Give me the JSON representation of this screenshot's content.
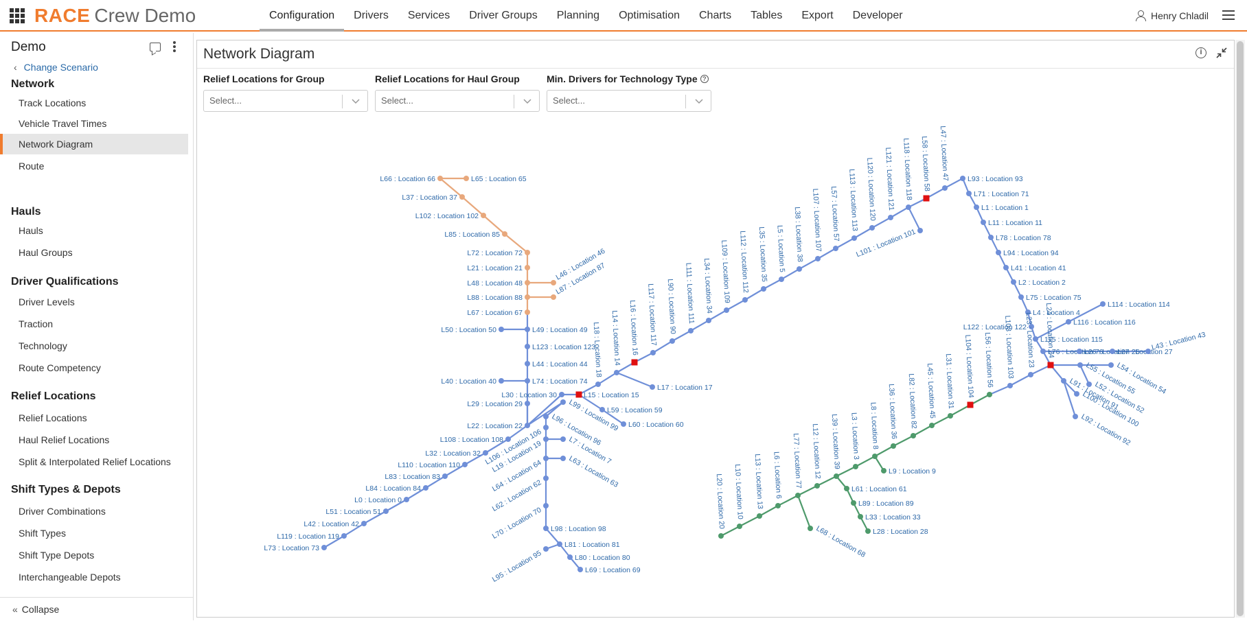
{
  "header": {
    "brand_race": "RACE",
    "brand_sub": "Crew Demo",
    "nav": [
      "Configuration",
      "Drivers",
      "Services",
      "Driver Groups",
      "Planning",
      "Optimisation",
      "Charts",
      "Tables",
      "Export",
      "Developer"
    ],
    "active_nav": "Configuration",
    "user": "Henry Chladil"
  },
  "sidebar": {
    "scenario": "Demo",
    "change_scenario": "Change Scenario",
    "sections": [
      {
        "title": "Network",
        "items": [
          "Track Locations",
          "Vehicle Travel Times",
          "Network Diagram",
          "Route"
        ]
      },
      {
        "title": "Hauls",
        "items": [
          "Hauls",
          "Haul Groups"
        ]
      },
      {
        "title": "Driver Qualifications",
        "items": [
          "Driver Levels",
          "Traction",
          "Technology",
          "Route Competency"
        ]
      },
      {
        "title": "Relief Locations",
        "items": [
          "Relief Locations",
          "Haul Relief Locations",
          "Split & Interpolated Relief Locations"
        ]
      },
      {
        "title": "Shift Types & Depots",
        "items": [
          "Driver Combinations",
          "Shift Types",
          "Shift Type Depots",
          "Interchangeable Depots"
        ]
      }
    ],
    "active_item": "Network Diagram",
    "collapse": "Collapse"
  },
  "panel": {
    "title": "Network Diagram",
    "filters": [
      {
        "label": "Relief Locations for Group",
        "placeholder": "Select..."
      },
      {
        "label": "Relief Locations for Haul Group",
        "placeholder": "Select..."
      },
      {
        "label": "Min. Drivers for Technology Type",
        "placeholder": "Select..."
      }
    ]
  },
  "colors": {
    "accent": "#f07c2e",
    "blue_line": "#6f8fd8",
    "orange_line": "#e8a87c",
    "green_line": "#4e9a6b",
    "label": "#2d68a8",
    "relief_marker": "#e01010"
  },
  "network": {
    "nodes": [
      {
        "id": "L66",
        "label": "L66 : Location 66",
        "line": "orange"
      },
      {
        "id": "L65",
        "label": "L65 : Location 65",
        "line": "orange"
      },
      {
        "id": "L37",
        "label": "L37 : Location 37",
        "line": "orange"
      },
      {
        "id": "L102",
        "label": "L102 : Location 102",
        "line": "orange"
      },
      {
        "id": "L85",
        "label": "L85 : Location 85",
        "line": "orange"
      },
      {
        "id": "L72",
        "label": "L72 : Location 72",
        "line": "orange"
      },
      {
        "id": "L21",
        "label": "L21 : Location 21",
        "line": "orange"
      },
      {
        "id": "L48",
        "label": "L48 : Location 48",
        "line": "orange"
      },
      {
        "id": "L46",
        "label": "L46 : Location 46",
        "line": "orange"
      },
      {
        "id": "L88",
        "label": "L88 : Location 88",
        "line": "orange"
      },
      {
        "id": "L87",
        "label": "L87 : Location 87",
        "line": "orange"
      },
      {
        "id": "L67",
        "label": "L67 : Location 67",
        "line": "orange"
      },
      {
        "id": "L50",
        "label": "L50 : Location 50",
        "line": "blue"
      },
      {
        "id": "L49",
        "label": "L49 : Location 49",
        "line": "blue"
      },
      {
        "id": "L123",
        "label": "L123 : Location 123",
        "line": "blue"
      },
      {
        "id": "L44",
        "label": "L44 : Location 44",
        "line": "blue"
      },
      {
        "id": "L40",
        "label": "L40 : Location 40",
        "line": "blue"
      },
      {
        "id": "L74",
        "label": "L74 : Location 74",
        "line": "blue"
      },
      {
        "id": "L29",
        "label": "L29 : Location 29",
        "line": "blue"
      },
      {
        "id": "L30",
        "label": "L30 : Location 30",
        "line": "blue"
      },
      {
        "id": "L15",
        "label": "L15 : Location 15",
        "line": "blue",
        "relief": true
      },
      {
        "id": "L22",
        "label": "L22 : Location 22",
        "line": "blue"
      },
      {
        "id": "L108",
        "label": "L108 : Location 108",
        "line": "blue"
      },
      {
        "id": "L32",
        "label": "L32 : Location 32",
        "line": "blue"
      },
      {
        "id": "L110",
        "label": "L110 : Location 110",
        "line": "blue"
      },
      {
        "id": "L83",
        "label": "L83 : Location 83",
        "line": "blue"
      },
      {
        "id": "L84",
        "label": "L84 : Location 84",
        "line": "blue"
      },
      {
        "id": "L0",
        "label": "L0 : Location 0",
        "line": "blue"
      },
      {
        "id": "L51",
        "label": "L51 : Location 51",
        "line": "blue"
      },
      {
        "id": "L42",
        "label": "L42 : Location 42",
        "line": "blue"
      },
      {
        "id": "L119",
        "label": "L119 : Location 119",
        "line": "blue"
      },
      {
        "id": "L73",
        "label": "L73 : Location 73",
        "line": "blue"
      },
      {
        "id": "L99",
        "label": "L99 : Location 99",
        "line": "blue"
      },
      {
        "id": "L96",
        "label": "L96 : Location 96",
        "line": "blue"
      },
      {
        "id": "L106",
        "label": "L106 : Location 106",
        "line": "blue"
      },
      {
        "id": "L19",
        "label": "L19 : Location 19",
        "line": "blue"
      },
      {
        "id": "L7",
        "label": "L7 : Location 7",
        "line": "blue"
      },
      {
        "id": "L64",
        "label": "L64 : Location 64",
        "line": "blue"
      },
      {
        "id": "L63",
        "label": "L63 : Location 63",
        "line": "blue"
      },
      {
        "id": "L62",
        "label": "L62 : Location 62",
        "line": "blue"
      },
      {
        "id": "L70",
        "label": "L70 : Location 70",
        "line": "blue"
      },
      {
        "id": "L98",
        "label": "L98 : Location 98",
        "line": "blue"
      },
      {
        "id": "L81",
        "label": "L81 : Location 81",
        "line": "blue"
      },
      {
        "id": "L80",
        "label": "L80 : Location 80",
        "line": "blue"
      },
      {
        "id": "L95",
        "label": "L95 : Location 95",
        "line": "blue"
      },
      {
        "id": "L69",
        "label": "L69 : Location 69",
        "line": "blue"
      },
      {
        "id": "L59",
        "label": "L59 : Location 59",
        "line": "blue"
      },
      {
        "id": "L60",
        "label": "L60 : Location 60",
        "line": "blue"
      },
      {
        "id": "L18",
        "label": "L18 : Location 18",
        "line": "blue"
      },
      {
        "id": "L14",
        "label": "L14 : Location 14",
        "line": "blue"
      },
      {
        "id": "L16",
        "label": "L16 : Location 16",
        "line": "blue",
        "relief": true
      },
      {
        "id": "L17",
        "label": "L17 : Location 17",
        "line": "blue"
      },
      {
        "id": "L117",
        "label": "L117 : Location 117",
        "line": "blue"
      },
      {
        "id": "L90",
        "label": "L90 : Location 90",
        "line": "blue"
      },
      {
        "id": "L111",
        "label": "L111 : Location 111",
        "line": "blue"
      },
      {
        "id": "L34",
        "label": "L34 : Location 34",
        "line": "blue"
      },
      {
        "id": "L109",
        "label": "L109 : Location 109",
        "line": "blue"
      },
      {
        "id": "L112",
        "label": "L112 : Location 112",
        "line": "blue"
      },
      {
        "id": "L35",
        "label": "L35 : Location 35",
        "line": "blue"
      },
      {
        "id": "L5",
        "label": "L5 : Location 5",
        "line": "blue"
      },
      {
        "id": "L38",
        "label": "L38 : Location 38",
        "line": "blue"
      },
      {
        "id": "L107",
        "label": "L107 : Location 107",
        "line": "blue"
      },
      {
        "id": "L57",
        "label": "L57 : Location 57",
        "line": "blue"
      },
      {
        "id": "L113",
        "label": "L113 : Location 113",
        "line": "blue"
      },
      {
        "id": "L120",
        "label": "L120 : Location 120",
        "line": "blue"
      },
      {
        "id": "L121",
        "label": "L121 : Location 121",
        "line": "blue"
      },
      {
        "id": "L118",
        "label": "L118 : Location 118",
        "line": "blue"
      },
      {
        "id": "L101",
        "label": "L101 : Location 101",
        "line": "blue"
      },
      {
        "id": "L58",
        "label": "L58 : Location 58",
        "line": "blue",
        "relief": true
      },
      {
        "id": "L47",
        "label": "L47 : Location 47",
        "line": "blue"
      },
      {
        "id": "L93",
        "label": "L93 : Location 93",
        "line": "blue"
      },
      {
        "id": "L71",
        "label": "L71 : Location 71",
        "line": "blue"
      },
      {
        "id": "L1",
        "label": "L1 : Location 1",
        "line": "blue"
      },
      {
        "id": "L11",
        "label": "L11 : Location 11",
        "line": "blue"
      },
      {
        "id": "L78",
        "label": "L78 : Location 78",
        "line": "blue"
      },
      {
        "id": "L94",
        "label": "L94 : Location 94",
        "line": "blue"
      },
      {
        "id": "L41",
        "label": "L41 : Location 41",
        "line": "blue"
      },
      {
        "id": "L2",
        "label": "L2 : Location 2",
        "line": "blue"
      },
      {
        "id": "L75",
        "label": "L75 : Location 75",
        "line": "blue"
      },
      {
        "id": "L4",
        "label": "L4 : Location 4",
        "line": "blue"
      },
      {
        "id": "L114",
        "label": "L114 : Location 114",
        "line": "blue"
      },
      {
        "id": "L116",
        "label": "L116 : Location 116",
        "line": "blue"
      },
      {
        "id": "L122",
        "label": "L122 : Location 122",
        "line": "blue"
      },
      {
        "id": "L115",
        "label": "L115 : Location 115",
        "line": "blue"
      },
      {
        "id": "L76",
        "label": "L76 : Location 76",
        "line": "blue"
      },
      {
        "id": "L26",
        "label": "L26 : Location 26",
        "line": "blue"
      },
      {
        "id": "L27",
        "label": "L27 : Location 27",
        "line": "blue"
      },
      {
        "id": "L43",
        "label": "L43 : Location 43",
        "line": "blue"
      },
      {
        "id": "L24",
        "label": "L24 : Location 24",
        "line": "blue",
        "relief": true
      },
      {
        "id": "L54",
        "label": "L54 : Location 54",
        "line": "blue"
      },
      {
        "id": "L55",
        "label": "L55 : Location 55",
        "line": "blue"
      },
      {
        "id": "L52",
        "label": "L52 : Location 52",
        "line": "blue"
      },
      {
        "id": "L91",
        "label": "L91 : Location 91",
        "line": "blue"
      },
      {
        "id": "L100",
        "label": "L100 : Location 100",
        "line": "blue"
      },
      {
        "id": "L92",
        "label": "L92 : Location 92",
        "line": "blue"
      },
      {
        "id": "L23",
        "label": "L23 : Location 23",
        "line": "blue"
      },
      {
        "id": "L103",
        "label": "L103 : Location 103",
        "line": "blue"
      },
      {
        "id": "L104",
        "label": "L104 : Location 104",
        "line": "green",
        "relief": true
      },
      {
        "id": "L56",
        "label": "L56 : Location 56",
        "line": "green"
      },
      {
        "id": "L31",
        "label": "L31 : Location 31",
        "line": "green"
      },
      {
        "id": "L45",
        "label": "L45 : Location 45",
        "line": "green"
      },
      {
        "id": "L82",
        "label": "L82 : Location 82",
        "line": "green"
      },
      {
        "id": "L36",
        "label": "L36 : Location 36",
        "line": "green"
      },
      {
        "id": "L8",
        "label": "L8 : Location 8",
        "line": "green"
      },
      {
        "id": "L9",
        "label": "L9 : Location 9",
        "line": "green"
      },
      {
        "id": "L3",
        "label": "L3 : Location 3",
        "line": "green"
      },
      {
        "id": "L39",
        "label": "L39 : Location 39",
        "line": "green"
      },
      {
        "id": "L61",
        "label": "L61 : Location 61",
        "line": "green"
      },
      {
        "id": "L89",
        "label": "L89 : Location 89",
        "line": "green"
      },
      {
        "id": "L33",
        "label": "L33 : Location 33",
        "line": "green"
      },
      {
        "id": "L28",
        "label": "L28 : Location 28",
        "line": "green"
      },
      {
        "id": "L12",
        "label": "L12 : Location 12",
        "line": "green"
      },
      {
        "id": "L77",
        "label": "L77 : Location 77",
        "line": "green"
      },
      {
        "id": "L68",
        "label": "L68 : Location 68",
        "line": "green"
      },
      {
        "id": "L6",
        "label": "L6 : Location 6",
        "line": "green"
      },
      {
        "id": "L13",
        "label": "L13 : Location 13",
        "line": "green"
      },
      {
        "id": "L10",
        "label": "L10 : Location 10",
        "line": "green"
      },
      {
        "id": "L20",
        "label": "L20 : Location 20",
        "line": "green"
      }
    ]
  }
}
